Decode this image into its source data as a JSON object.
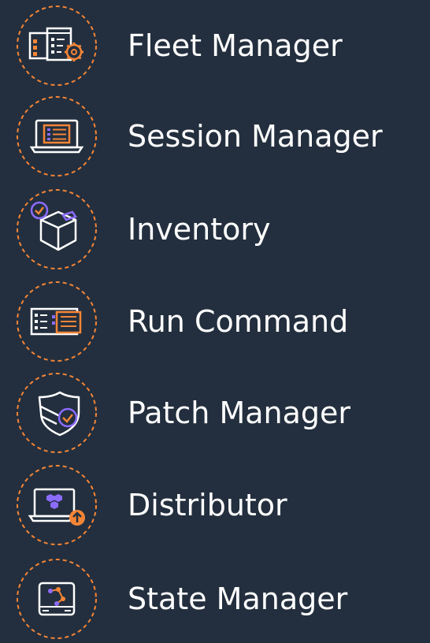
{
  "colors": {
    "background": "#232f3e",
    "ring": "#f58536",
    "icon_white": "#ffffff",
    "accent_orange": "#f58536",
    "accent_purple": "#8c6cff"
  },
  "items": [
    {
      "label": "Fleet Manager",
      "icon": "fleet-manager-icon"
    },
    {
      "label": "Session Manager",
      "icon": "session-manager-icon"
    },
    {
      "label": "Inventory",
      "icon": "inventory-icon"
    },
    {
      "label": "Run Command",
      "icon": "run-command-icon"
    },
    {
      "label": "Patch Manager",
      "icon": "patch-manager-icon"
    },
    {
      "label": "Distributor",
      "icon": "distributor-icon"
    },
    {
      "label": "State Manager",
      "icon": "state-manager-icon"
    }
  ]
}
